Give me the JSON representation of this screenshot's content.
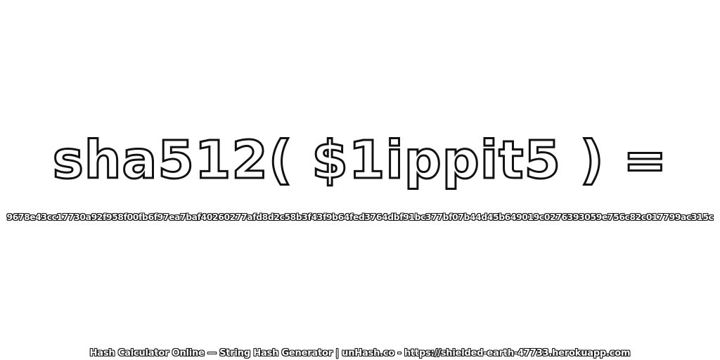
{
  "headline": "sha512( $1ippit5 ) =",
  "hash_value": "9678e43cc17730a92f958f00fb6f97ea7baf40260277afd8d2c58b3f43f9b64fed3764dbf91bc377bf07b44d45b649019c0276393059e756c82c017799ac315c",
  "footer": "Hash Calculator Online — String Hash Generator | unHash.co - https://shielded-earth-47733.herokuapp.com",
  "colors": {
    "text_fill": "#ffffff",
    "text_outline": "#111111",
    "background": "#ffffff"
  }
}
